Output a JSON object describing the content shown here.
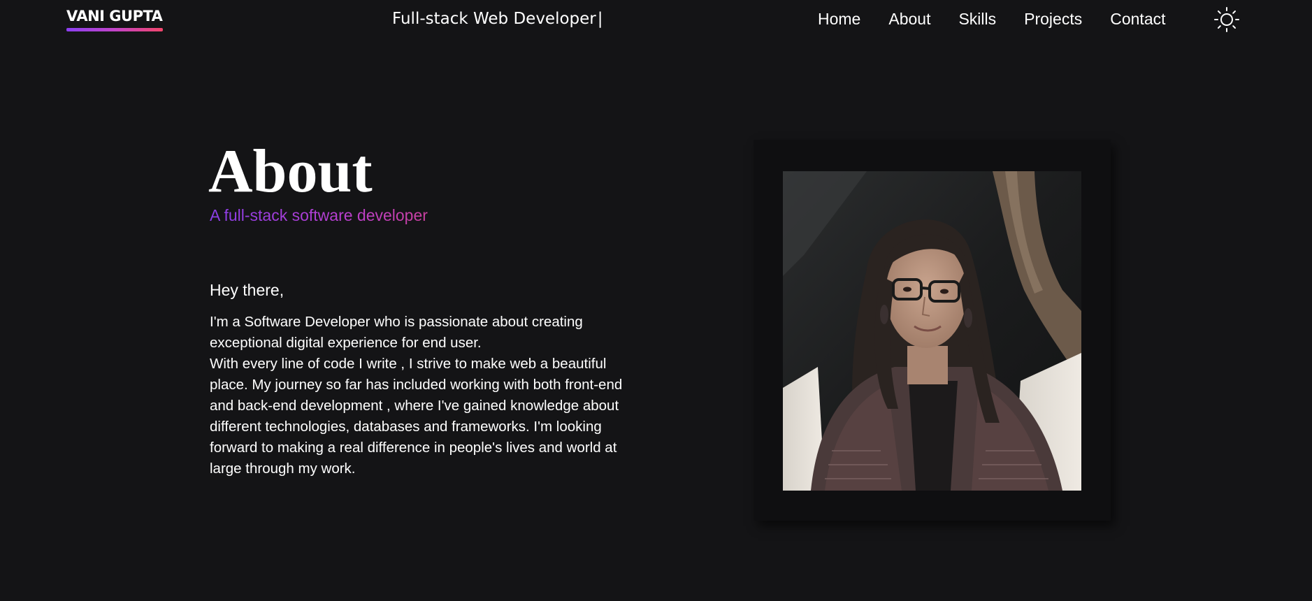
{
  "header": {
    "logo": "VANI GUPTA",
    "typed_text": "Full-stack Web Developer",
    "caret": "|",
    "nav": [
      "Home",
      "About",
      "Skills",
      "Projects",
      "Contact"
    ],
    "theme_icon": "sun-icon"
  },
  "about": {
    "title": "About",
    "subtitle": "A full-stack software developer",
    "greeting": "Hey there,",
    "bio_p1": "I'm a Software Developer who is passionate about creating exceptional digital experience for end user.",
    "bio_p2": "With every line of code I write , I strive to make web a beautiful place. My journey so far has included working with both front-end and back-end development , where I've gained knowledge about different technologies, databases and frameworks. I'm looking forward to making a real difference in people's lives and world at large through my work."
  },
  "colors": {
    "background": "#141416",
    "text": "#ffffff",
    "accent_start": "#8b3ff0",
    "accent_end": "#f2456b",
    "photo_frame": "#0f0f11"
  }
}
